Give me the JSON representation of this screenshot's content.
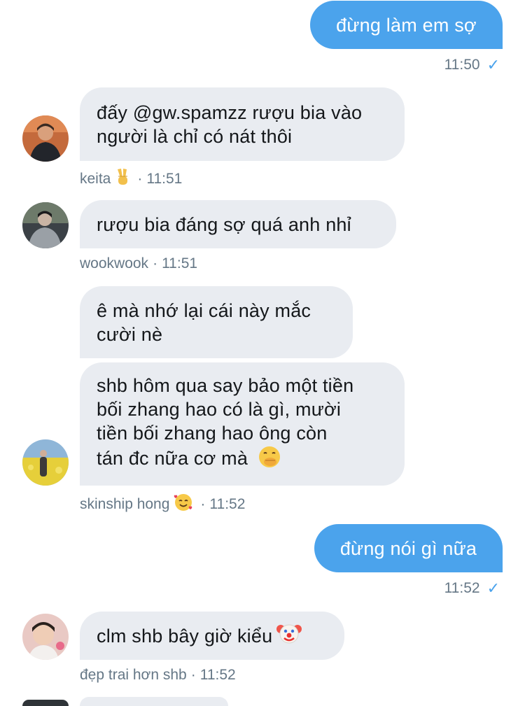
{
  "messages": [
    {
      "type": "sent",
      "text": "đừng làm em sợ",
      "time": "11:50"
    },
    {
      "type": "received",
      "lines": [
        "đấy @gw.spamzz rượu bia vào",
        "người là chỉ có nát thôi"
      ],
      "sender": "keita",
      "sender_emoji": "victory-hand",
      "time": "11:51"
    },
    {
      "type": "received",
      "lines": [
        "rượu bia đáng sợ quá anh nhỉ"
      ],
      "sender": "wookwook",
      "time": "11:51"
    },
    {
      "type": "received",
      "lines": [
        "ê mà nhớ lại cái này mắc",
        "cười nè"
      ]
    },
    {
      "type": "received",
      "lines": [
        "shb hôm qua say bảo một tiền",
        "bối zhang hao có là gì, mười",
        "tiền bối zhang hao ông còn",
        "tán đc nữa cơ mà"
      ],
      "emoji": "face-with-hand-over-mouth",
      "sender": "skinship hong",
      "sender_emoji": "smiling-face-with-hearts",
      "time": "11:52"
    },
    {
      "type": "sent",
      "text": "đừng nói gì nữa",
      "time": "11:52"
    },
    {
      "type": "received",
      "lines": [
        "clm shb bây giờ kiểu"
      ],
      "emoji": "clown-face",
      "sender": "đẹp trai hơn shb",
      "time": "11:52"
    }
  ],
  "separator": "·",
  "check_mark": "✓",
  "colors": {
    "sent_bubble": "#4ba3ec",
    "received_bubble": "#e9ecf1",
    "meta_text": "#657786"
  }
}
